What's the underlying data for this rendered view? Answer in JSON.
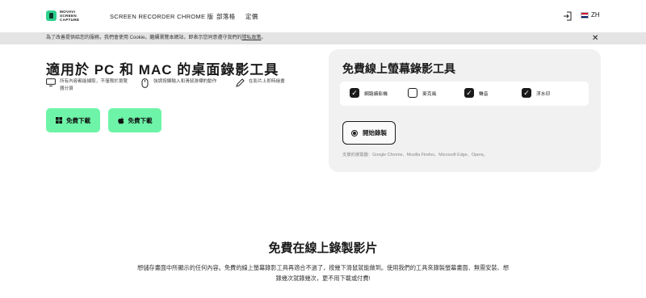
{
  "header": {
    "logo_text": "MOVAVI SCREEN CAPTURE",
    "nav": [
      {
        "label": "SCREEN RECORDER CHROME 版"
      },
      {
        "label": "部落格"
      },
      {
        "label": "定價"
      }
    ],
    "lang": "ZH"
  },
  "cookie": {
    "text": "為了改善提供給您的服務，我們會使用 Cookie。繼續瀏覽本網站，即表示您同意遵守我們的",
    "link": "隱私政策",
    "end": "。",
    "close": "✕"
  },
  "hero": {
    "title": "適用於 PC 和 MAC 的桌面錄影工具",
    "features": [
      {
        "icon": "monitor-icon",
        "text": "所有內容都能擷取，不僅限於瀏覽器分頁"
      },
      {
        "icon": "mouse-icon",
        "text": "強調按鍵輸入和滑鼠游標的動作"
      },
      {
        "icon": "pencil-icon",
        "text": "在影片上即時繪畫"
      }
    ],
    "download_windows": "免費下載",
    "download_mac": "免費下載"
  },
  "recorder": {
    "title": "免費線上螢幕錄影工具",
    "options": [
      {
        "label": "網路攝影機",
        "checked": true
      },
      {
        "label": "麥克風",
        "checked": false
      },
      {
        "label": "聲音",
        "checked": true
      },
      {
        "label": "浮水印",
        "checked": true
      }
    ],
    "start_label": "開始錄製",
    "browsers": "支援的瀏覽器：Google Chrome、Mozilla Firefox、Microsoft Edge、Opera。"
  },
  "section": {
    "title": "免費在線上錄製影片",
    "text": "想儲存畫面中所顯示的任何內容。免費的線上螢幕錄影工具再適合不過了，按幾下滑鼠就能做到。使用我們的工具來錄製螢幕畫面、無需安裝、想錄幾次就錄幾次，更不用下載或付費!"
  },
  "colors": {
    "accent": "#6ef4a8",
    "panel": "#f1f1f1",
    "cookie_bar": "#e4e4e4"
  }
}
